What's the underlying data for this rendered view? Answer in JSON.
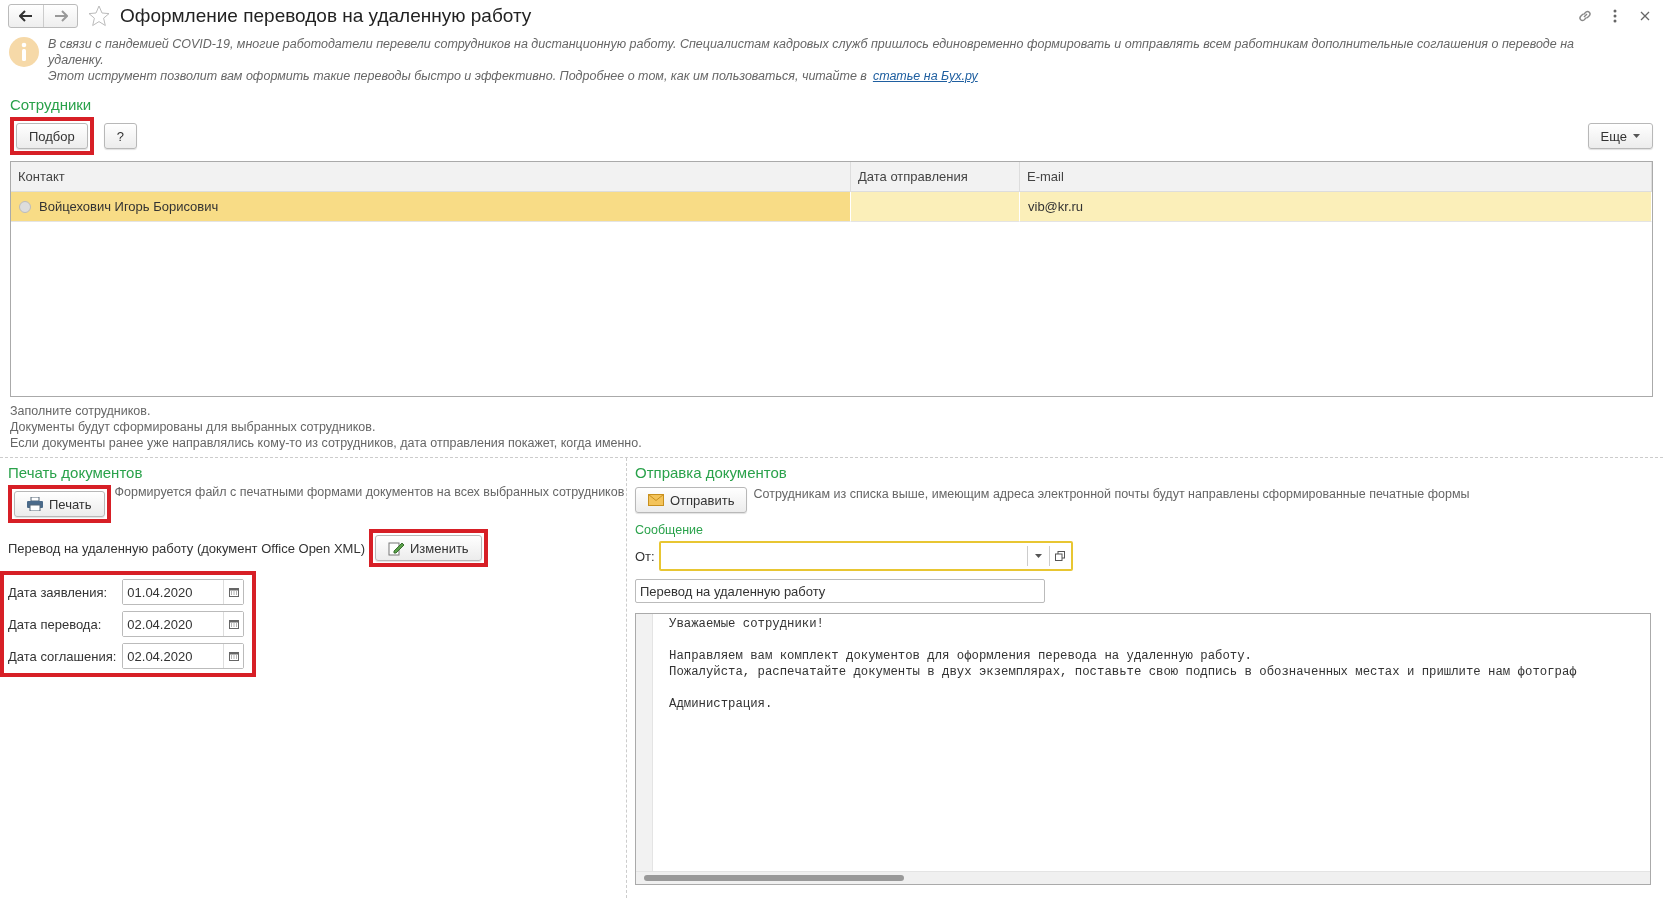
{
  "window": {
    "title": "Оформление переводов на удаленную работу",
    "favorite": false
  },
  "info": {
    "lines": [
      "В связи с пандемией COVID-19, многие работодатели перевели сотрудников на дистанционную работу. Специалистам кадровых служб пришлось единовременно формировать и отправлять всем работникам дополнительные соглашения о переводе на удаленку.",
      "Этот иструмент позволит вам оформить такие переводы быстро и эффективно. Подробнее о том, как им пользоваться, читайте в"
    ],
    "link": "статье на Бух.ру"
  },
  "employees": {
    "title": "Сотрудники",
    "pick_button": {
      "label": "Подбор",
      "highlighted": true
    },
    "help_button": "?",
    "more_button": "Еще",
    "table": {
      "columns": [
        "Контакт",
        "Дата отправления",
        "E-mail"
      ],
      "rows": [
        {
          "contact": "Войцехович Игорь Борисович",
          "sent_date": "",
          "email": "vib@kr.ru",
          "selected": true
        }
      ]
    },
    "notes": [
      "Заполните сотрудников.",
      "Документы будут сформированы для выбранных сотрудников.",
      "Если документы ранее уже направлялись кому-то из сотрудников, дата отправления покажет, когда именно."
    ]
  },
  "print": {
    "title": "Печать документов",
    "print_button": {
      "label": "Печать",
      "highlighted": true
    },
    "description": "Формируется файл с печатными формами документов на всех выбранных сотрудников",
    "template": "Перевод на удаленную работу (документ Office Open XML)",
    "edit_button": {
      "label": "Изменить",
      "highlighted": true
    },
    "dates_highlighted": true,
    "dates": [
      {
        "label": "Дата заявления:",
        "value": "01.04.2020"
      },
      {
        "label": "Дата перевода:",
        "value": "02.04.2020"
      },
      {
        "label": "Дата соглашения:",
        "value": "02.04.2020"
      }
    ]
  },
  "send": {
    "title": "Отправка документов",
    "send_button": "Отправить",
    "description": "Сотрудникам из списка выше, имеющим адреса электронной почты будут направлены сформированные печатные формы",
    "message_title": "Сообщение",
    "from_label": "От:",
    "subject": "Перевод на удаленную работу",
    "body": [
      [
        "Уважаемые сотрудники!"
      ],
      [
        "Направляем вам комплект документов для оформления перевода на удаленную работу.",
        "Пожалуйста, распечатайте документы в двух экземплярах, поставьте свою подпись в обозначенных местах и пришлите нам фотограф"
      ],
      [
        "Администрация."
      ]
    ]
  }
}
